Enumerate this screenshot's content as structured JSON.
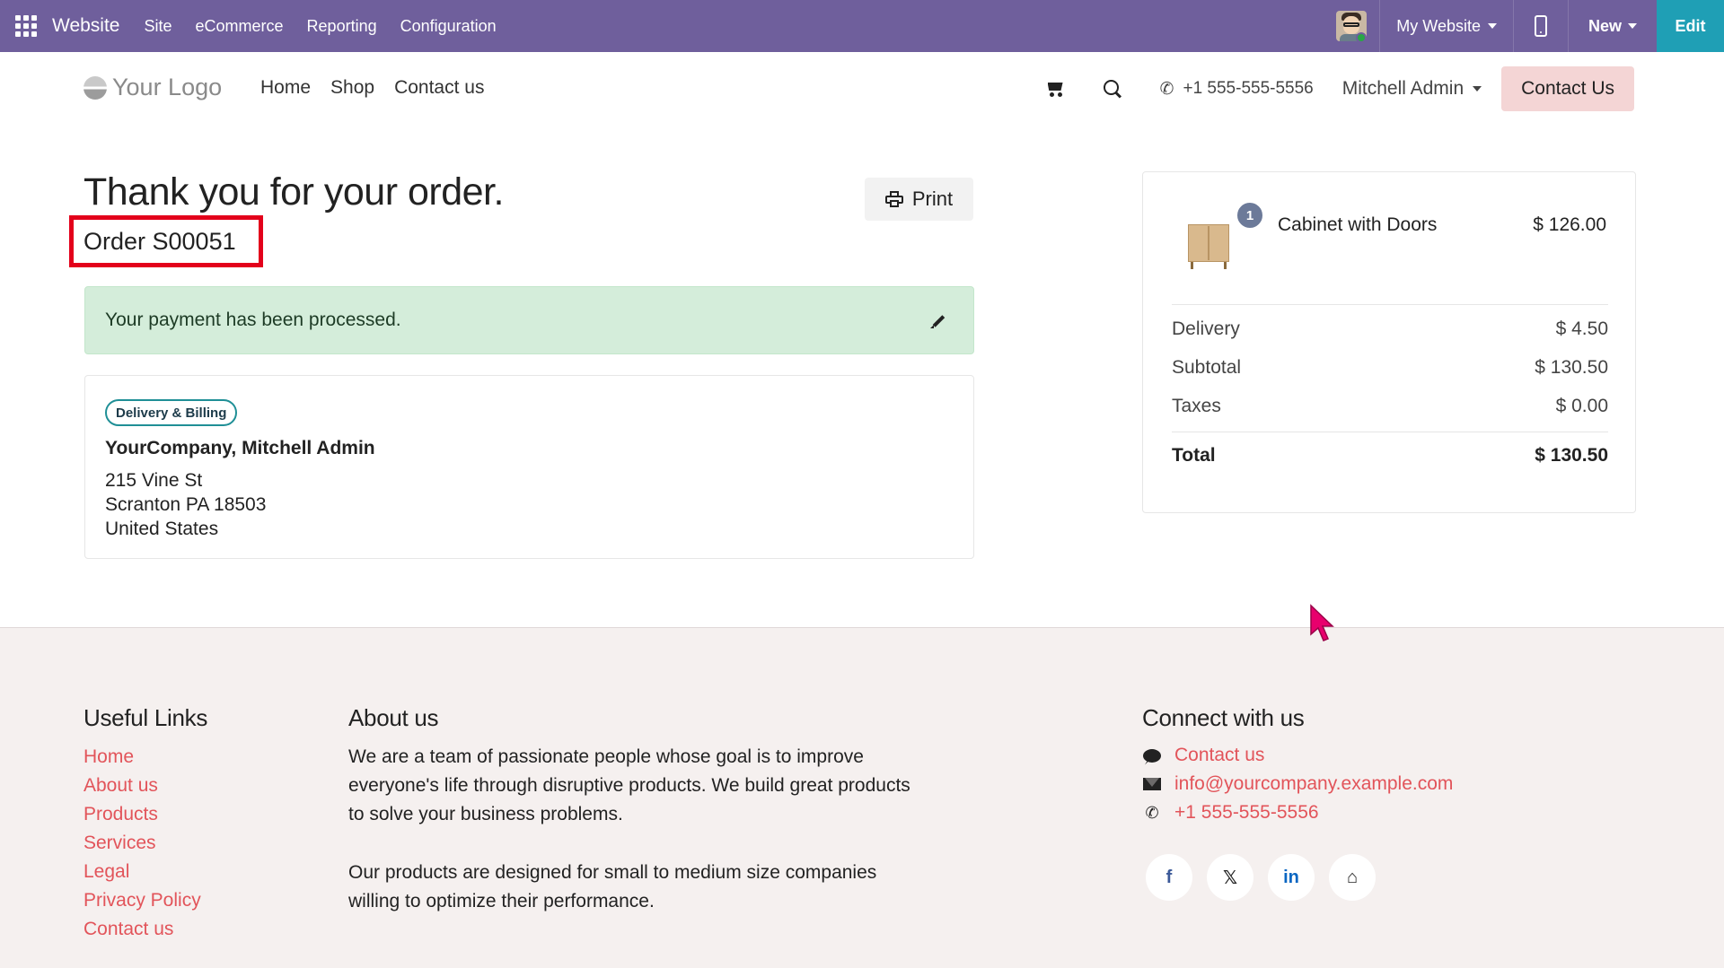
{
  "topbar": {
    "brand": "Website",
    "menu": [
      "Site",
      "eCommerce",
      "Reporting",
      "Configuration"
    ],
    "my_website": "My Website",
    "new_label": "New",
    "edit_label": "Edit"
  },
  "header": {
    "logo_text": "Your Logo",
    "nav": [
      "Home",
      "Shop",
      "Contact us"
    ],
    "phone": "+1 555-555-5556",
    "user": "Mitchell Admin",
    "contact_button": "Contact Us"
  },
  "order": {
    "title": "Thank you for your order.",
    "number": "Order S00051",
    "print_label": "Print",
    "payment_message": "Your payment has been processed.",
    "address_badge": "Delivery & Billing",
    "address_name": "YourCompany, Mitchell Admin",
    "address_lines": [
      "215 Vine St",
      "Scranton PA 18503",
      "United States"
    ]
  },
  "summary": {
    "item": {
      "qty": "1",
      "name": "Cabinet with Doors",
      "price": "$ 126.00"
    },
    "rows": [
      {
        "label": "Delivery",
        "value": "$ 4.50"
      },
      {
        "label": "Subtotal",
        "value": "$ 130.50"
      },
      {
        "label": "Taxes",
        "value": "$ 0.00"
      }
    ],
    "total": {
      "label": "Total",
      "value": "$ 130.50"
    }
  },
  "footer": {
    "useful_links_title": "Useful Links",
    "useful_links": [
      "Home",
      "About us",
      "Products",
      "Services",
      "Legal",
      "Privacy Policy",
      "Contact us"
    ],
    "about_title": "About us",
    "about_p1_lines": [
      "We are a team of passionate people whose goal is to improve",
      "everyone's life through disruptive products. We build great products",
      "to solve your business problems."
    ],
    "about_p2_lines": [
      "Our products are designed for small to medium size companies",
      "willing to optimize their performance."
    ],
    "connect_title": "Connect with us",
    "contact_us": "Contact us",
    "email": "info@yourcompany.example.com",
    "phone": "+1 555-555-5556",
    "social_icons": [
      "facebook-icon",
      "x-icon",
      "linkedin-icon",
      "home-icon"
    ],
    "social_glyphs": [
      "f",
      "𝕏",
      "in",
      "⌂"
    ]
  },
  "colors": {
    "topbar": "#6f5f9c",
    "edit_button": "#1f9fb5",
    "highlight_box": "#e3001b",
    "link": "#e2545a",
    "success_bg": "#d4edda",
    "contact_btn_bg": "#f4d5d5",
    "cursor": "#e8006d"
  }
}
